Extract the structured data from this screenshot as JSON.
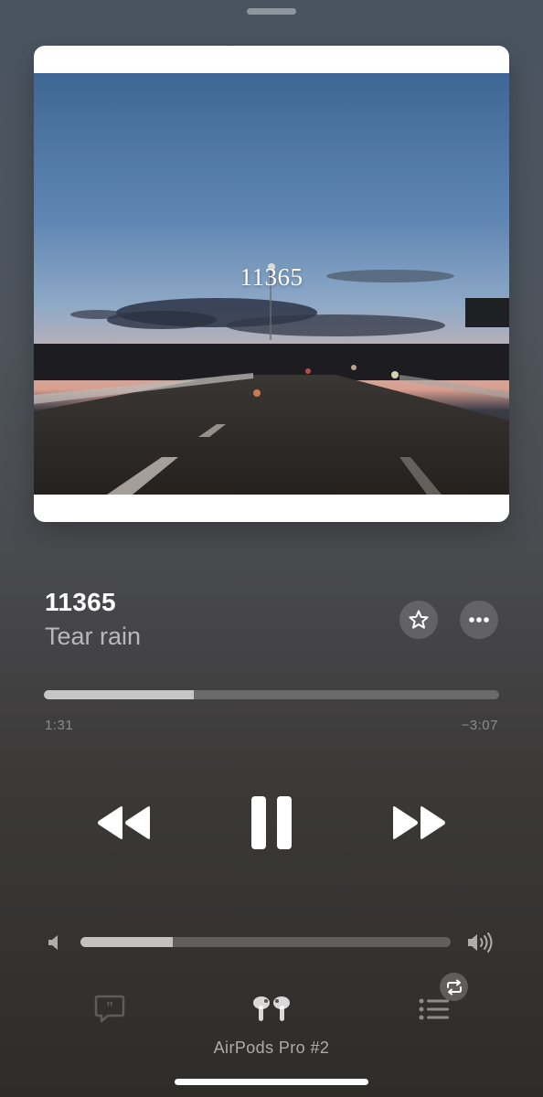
{
  "artwork": {
    "overlay_text": "11365"
  },
  "track": {
    "title": "11365",
    "artist": "Tear rain"
  },
  "actions": {
    "favorite_icon": "star-icon",
    "more_icon": "ellipsis-icon"
  },
  "progress": {
    "elapsed": "1:31",
    "remaining": "−3:07",
    "fraction": 0.33
  },
  "transport": {
    "rewind_icon": "rewind-icon",
    "pause_icon": "pause-icon",
    "forward_icon": "fast-forward-icon"
  },
  "volume": {
    "level": 0.25,
    "low_icon": "speaker-low-icon",
    "high_icon": "speaker-high-icon"
  },
  "bottom_bar": {
    "lyrics_icon": "lyrics-icon",
    "output_icon": "airpods-pro-icon",
    "queue_icon": "queue-list-icon",
    "repeat_icon": "repeat-icon",
    "output_device": "AirPods Pro #2"
  },
  "colors": {
    "accent": "#ffffff",
    "background_top": "#4a5461",
    "background_bottom": "#2f2b28"
  }
}
